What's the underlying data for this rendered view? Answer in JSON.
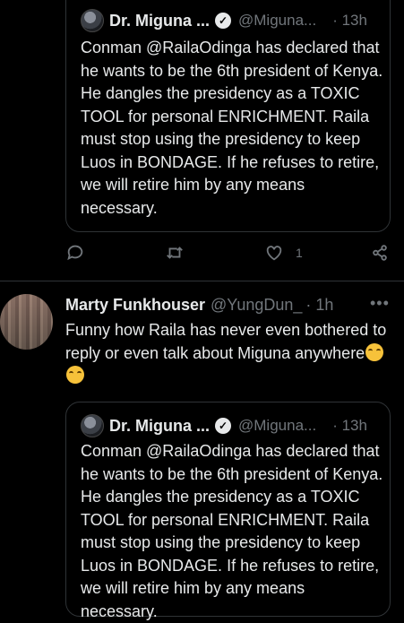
{
  "quoted_tweet": {
    "author_name": "Dr. Miguna ...",
    "author_handle": "@Miguna...",
    "time": "· 13h",
    "text": "Conman @RailaOdinga has declared that he wants to be the 6th president of Kenya. He dangles the presidency as a TOXIC TOOL for personal ENRICHMENT. Raila must stop using the presidency to keep Luos in BONDAGE. If he refuses to retire, we will retire him by any means necessary."
  },
  "actions": {
    "reply_icon": "reply-icon",
    "retweet_icon": "retweet-icon",
    "like_icon": "heart-icon",
    "like_count": "1",
    "share_icon": "share-icon"
  },
  "reply_tweet": {
    "author_name": "Marty Funkhouser",
    "author_handle": "@YungDun_",
    "time": "· 1h",
    "more": "•••",
    "text": "Funny how Raila has never even bothered to reply or even talk about Miguna anywhere",
    "emoji": "😂😂"
  },
  "quoted_tweet_2": {
    "author_name": "Dr. Miguna ...",
    "author_handle": "@Miguna...",
    "time": "· 13h",
    "text": "Conman @RailaOdinga has declared that he wants to be the 6th president of Kenya. He dangles the presidency as a TOXIC TOOL for personal ENRICHMENT. Raila must stop using the presidency to keep Luos in BONDAGE. If he refuses to retire, we will retire him by any means necessary."
  },
  "colors": {
    "background": "#000000",
    "text": "#e7e9ea",
    "muted": "#71767b",
    "border": "#2f3336"
  }
}
